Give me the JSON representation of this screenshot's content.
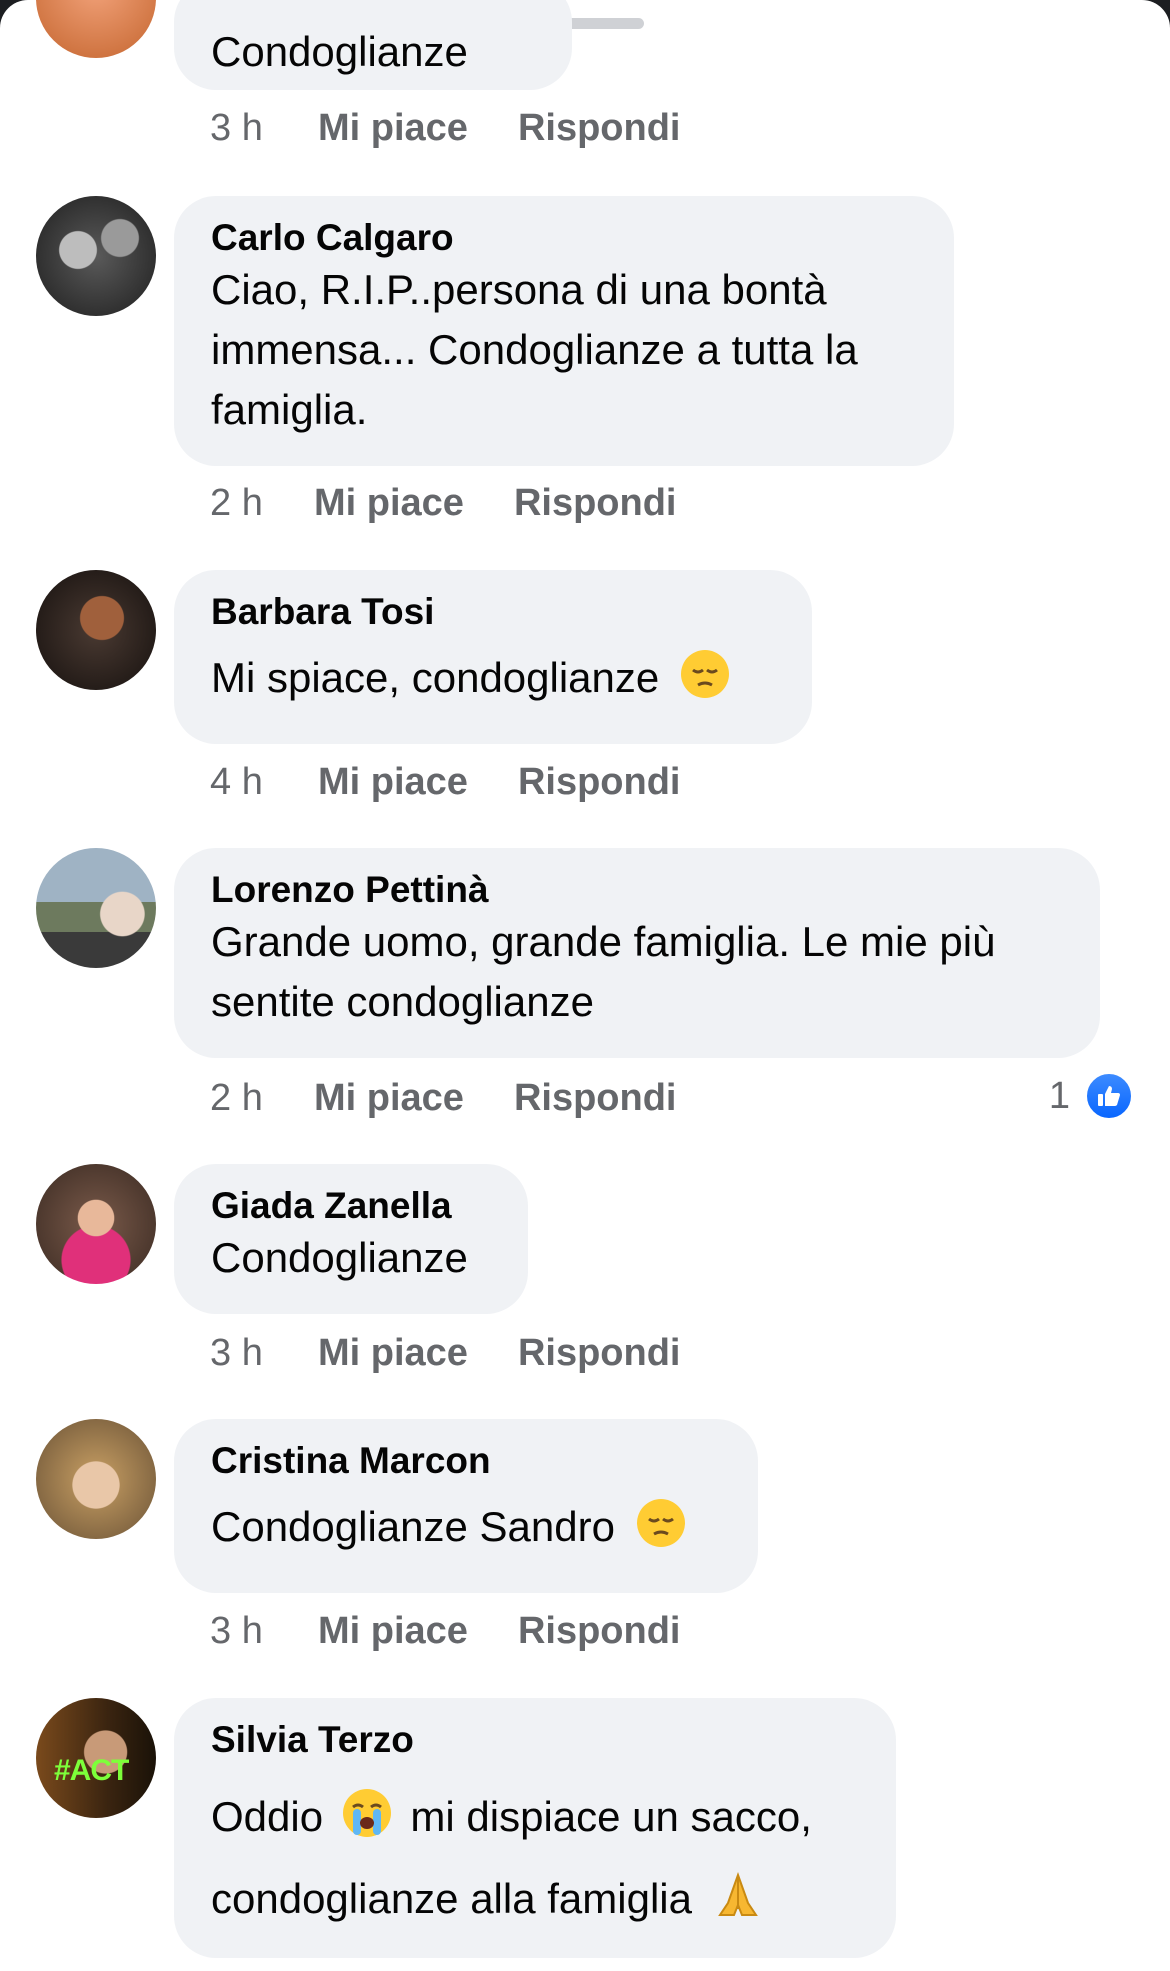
{
  "comments": [
    {
      "author": "",
      "text": "Condoglianze",
      "time": "3 h",
      "like_label": "Mi piace",
      "reply_label": "Rispondi",
      "emoji": ""
    },
    {
      "author": "Carlo Calgaro",
      "text": "Ciao, R.I.P..persona di una bontà immensa... Condoglianze a tutta la famiglia.",
      "time": "2 h",
      "like_label": "Mi piace",
      "reply_label": "Rispondi",
      "emoji": ""
    },
    {
      "author": "Barbara Tosi",
      "text": "Mi spiace, condoglianze",
      "time": "4 h",
      "like_label": "Mi piace",
      "reply_label": "Rispondi",
      "emoji": "pensive-face"
    },
    {
      "author": "Lorenzo Pettinà",
      "text": "Grande uomo, grande famiglia. Le mie più sentite condoglianze",
      "time": "2 h",
      "like_label": "Mi piace",
      "reply_label": "Rispondi",
      "reaction_count": "1",
      "reaction_icon": "like-reaction-icon"
    },
    {
      "author": "Giada Zanella",
      "text": "Condoglianze",
      "time": "3 h",
      "like_label": "Mi piace",
      "reply_label": "Rispondi"
    },
    {
      "author": "Cristina Marcon",
      "text": "Condoglianze Sandro",
      "time": "3 h",
      "like_label": "Mi piace",
      "reply_label": "Rispondi",
      "emoji": "pensive-face"
    },
    {
      "author": "Silvia Terzo",
      "text_part1": "Oddio",
      "text_part2": "mi dispiace un sacco,",
      "text_part3": "condoglianze alla famiglia",
      "emoji1": "loudly-crying-face",
      "emoji2": "folded-hands"
    }
  ],
  "avatar_overlay_text": "#ACT",
  "colors": {
    "bubble": "#f0f2f5",
    "meta_text": "#65676b",
    "like_blue": "#0866ff"
  }
}
